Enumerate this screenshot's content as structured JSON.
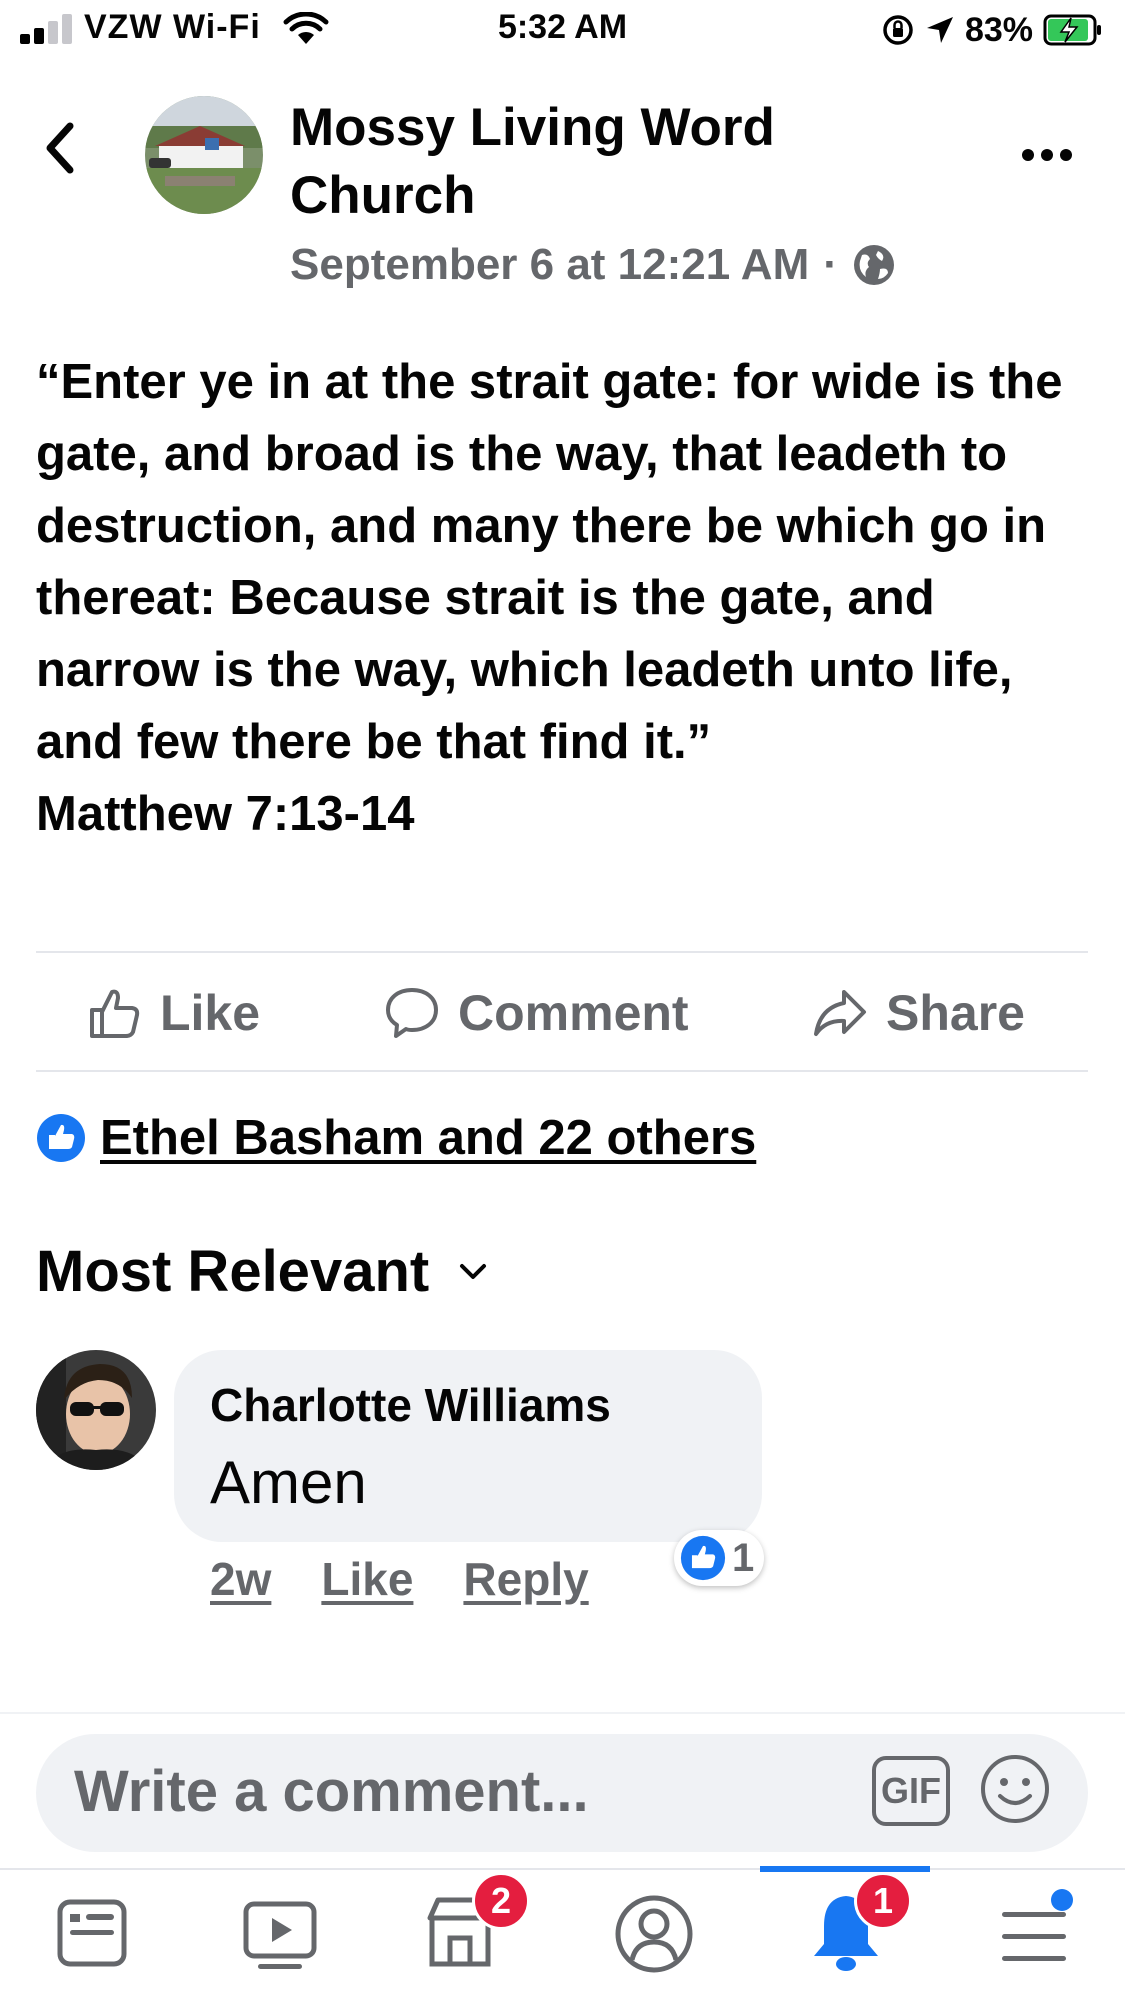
{
  "status_bar": {
    "carrier": "VZW Wi-Fi",
    "time": "5:32 AM",
    "battery": "83%"
  },
  "header": {
    "page_name": "Mossy Living Word Church",
    "timestamp": "September 6 at 12:21 AM",
    "separator": "·",
    "privacy_icon": "globe-icon"
  },
  "post": {
    "text": "“Enter ye in at the strait gate: for wide is the gate, and broad is the way, that leadeth to destruction, and many there be which go in thereat: Because strait is the gate, and narrow is the way, which leadeth unto life, and few there be that find it.”\nMatthew 7:13-14"
  },
  "actions": {
    "like": "Like",
    "comment": "Comment",
    "share": "Share"
  },
  "reactions": {
    "summary": "Ethel Basham and 22 others"
  },
  "comments": {
    "sort_label": "Most Relevant",
    "items": [
      {
        "author": "Charlotte Williams",
        "text": "Amen",
        "time": "2w",
        "like_label": "Like",
        "reply_label": "Reply",
        "reaction_count": "1"
      }
    ]
  },
  "composer": {
    "placeholder": "Write a comment...",
    "gif_label": "GIF"
  },
  "tabbar": {
    "marketplace_badge": "2",
    "notifications_badge": "1"
  },
  "colors": {
    "accent": "#1877f2",
    "secondary_text": "#65676b",
    "badge": "#e41e3f",
    "bubble": "#f0f2f5"
  }
}
